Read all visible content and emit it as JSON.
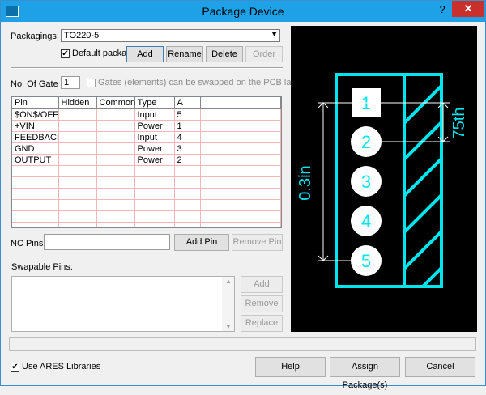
{
  "window": {
    "title": "Package Device",
    "help_glyph": "?",
    "close_glyph": "✕"
  },
  "packagings": {
    "label": "Packagings:",
    "value": "TO220-5"
  },
  "default_package": {
    "label": "Default package?",
    "checked": true
  },
  "buttons": {
    "add": "Add",
    "rename": "Rename",
    "delete": "Delete",
    "order": "Order"
  },
  "gates": {
    "label": "No. Of Gate :",
    "value": "1",
    "swap_label": "Gates (elements) can be swapped on the PCB layout?"
  },
  "pin_table": {
    "columns": [
      "Pin",
      "Hidden",
      "Common",
      "Type",
      "A"
    ],
    "rows": [
      [
        "$ON$/OFF",
        "",
        "",
        "Input",
        "5"
      ],
      [
        "+VIN",
        "",
        "",
        "Power",
        "1"
      ],
      [
        "FEEDBACK",
        "",
        "",
        "Input",
        "4"
      ],
      [
        "GND",
        "",
        "",
        "Power",
        "3"
      ],
      [
        "OUTPUT",
        "",
        "",
        "Power",
        "2"
      ],
      [
        "",
        "",
        "",
        "",
        ""
      ],
      [
        "",
        "",
        "",
        "",
        ""
      ],
      [
        "",
        "",
        "",
        "",
        ""
      ],
      [
        "",
        "",
        "",
        "",
        ""
      ],
      [
        "",
        "",
        "",
        "",
        ""
      ],
      [
        "",
        "",
        "",
        "",
        ""
      ]
    ]
  },
  "nc_pins": {
    "label": "NC Pins:",
    "value": "",
    "add_pin": "Add Pin",
    "remove_pin": "Remove Pin"
  },
  "swapable": {
    "label": "Swapable Pins:",
    "add": "Add",
    "remove": "Remove",
    "replace": "Replace"
  },
  "preview": {
    "pins": [
      "1",
      "2",
      "3",
      "4",
      "5"
    ],
    "dim_height": "0.3in",
    "dim_pitch": "75th",
    "outline_color": "#00e5ee",
    "dim_color": "#ffffff"
  },
  "footer": {
    "use_ares_label": "Use ARES Libraries",
    "use_ares_checked": true,
    "help": "Help",
    "assign": "Assign Package(s)",
    "cancel": "Cancel"
  }
}
